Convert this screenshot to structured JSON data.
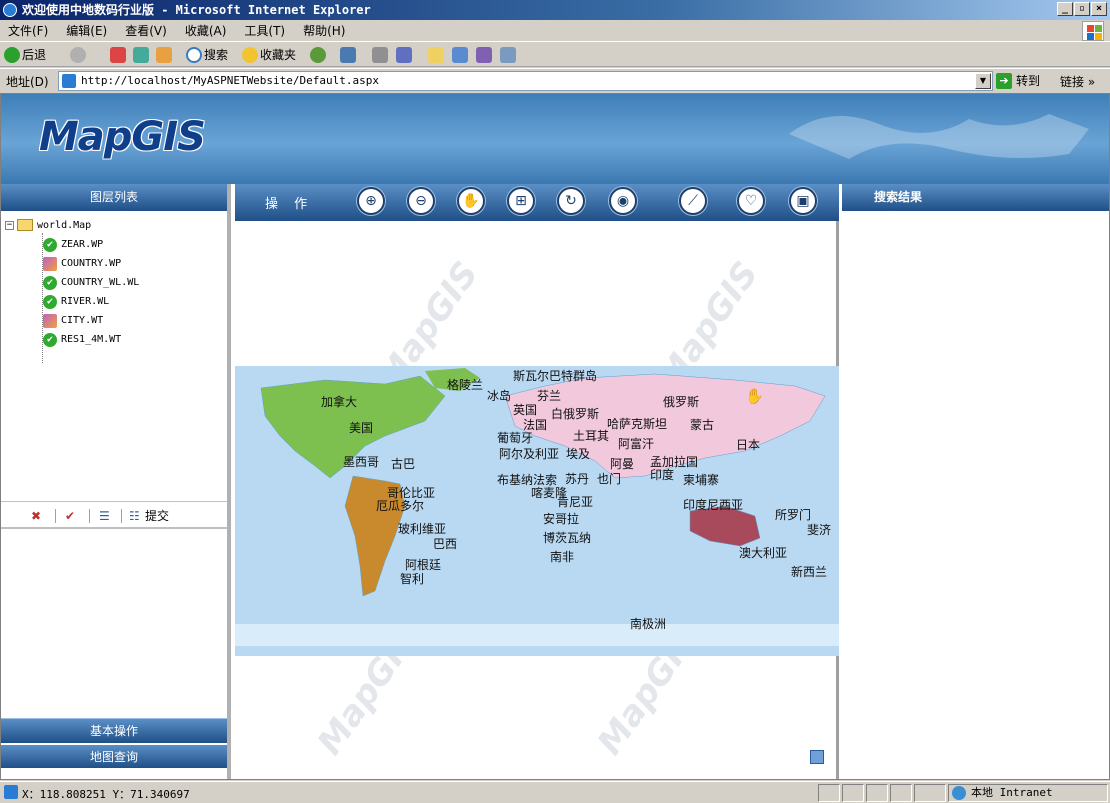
{
  "window": {
    "title": "欢迎使用中地数码行业版 - Microsoft Internet Explorer",
    "min": "_",
    "max": "▫",
    "close": "×"
  },
  "menu": [
    "文件(F)",
    "编辑(E)",
    "查看(V)",
    "收藏(A)",
    "工具(T)",
    "帮助(H)"
  ],
  "toolbar": {
    "back": "后退",
    "search": "搜索",
    "favorites": "收藏夹"
  },
  "address": {
    "label": "地址(D)",
    "url": "http://localhost/MyASPNETWebsite/Default.aspx",
    "go": "转到",
    "links": "链接 »"
  },
  "logo": "MapGIS",
  "left": {
    "header": "图层列表",
    "root": "world.Map",
    "layers": [
      {
        "name": "ZEAR.WP",
        "state": "check"
      },
      {
        "name": "COUNTRY.WP",
        "state": "edit"
      },
      {
        "name": "COUNTRY_WL.WL",
        "state": "check"
      },
      {
        "name": "RIVER.WL",
        "state": "check"
      },
      {
        "name": "CITY.WT",
        "state": "edit"
      },
      {
        "name": "RES1_4M.WT",
        "state": "check"
      }
    ],
    "tools": {
      "delete": "✖",
      "check": "✔",
      "list": "☰",
      "submit": "提交"
    },
    "nav_basic": "基本操作",
    "nav_query": "地图查询"
  },
  "center": {
    "header": "操 作",
    "tools": [
      "zoom-in",
      "zoom-out",
      "pan",
      "full-extent",
      "refresh",
      "eye",
      "measure",
      "select",
      "save"
    ],
    "watermark": "MapGIS",
    "places": {
      "greenland": "格陵兰",
      "svalbard": "斯瓦尔巴特群岛",
      "canada": "加拿大",
      "iceland": "冰岛",
      "finland": "芬兰",
      "russia": "俄罗斯",
      "uk": "英国",
      "belarus": "白俄罗斯",
      "usa": "美国",
      "france": "法国",
      "portugal": "葡萄牙",
      "kazakhstan": "哈萨克斯坦",
      "mongolia": "蒙古",
      "turkey": "土耳其",
      "algeria": "阿尔及利亚",
      "egypt": "埃及",
      "afghanistan": "阿富汗",
      "japan": "日本",
      "mexico": "墨西哥",
      "cuba": "古巴",
      "oman": "阿曼",
      "bangladesh": "孟加拉国",
      "india": "印度",
      "burkina": "布基纳法索",
      "sudan": "苏丹",
      "yemen": "也门",
      "cambodia": "柬埔寨",
      "cameroon": "喀麦隆",
      "colombia": "哥伦比亚",
      "ecuador": "厄瓜多尔",
      "kenya": "肯尼亚",
      "indonesia": "印度尼西亚",
      "solomon": "所罗门",
      "fiji": "斐济",
      "angola": "安哥拉",
      "bolivia": "玻利维亚",
      "brazil": "巴西",
      "botswana": "博茨瓦纳",
      "australia": "澳大利亚",
      "south_africa": "南非",
      "argentina": "阿根廷",
      "nz": "新西兰",
      "chile": "智利",
      "antarctica": "南极洲"
    }
  },
  "right": {
    "header": "搜索结果"
  },
  "status": {
    "coords": "X：118.808251 Y：71.340697",
    "zone": "本地 Intranet"
  },
  "colors": {
    "header": "#2a5d95",
    "ocean": "#b9d9f2",
    "americas": "#7ec050",
    "europe_asia": "#f2c8dc",
    "south_america": "#c98a2e",
    "oceania": "#a84a5c",
    "africa": "#b9d9f2"
  }
}
